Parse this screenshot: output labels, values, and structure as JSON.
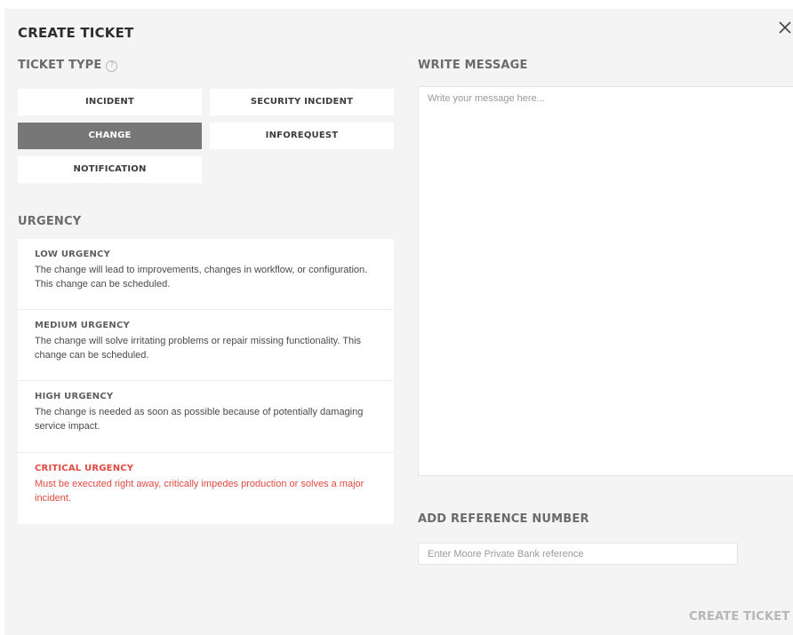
{
  "modal": {
    "title": "CREATE TICKET",
    "close_icon": "close-icon"
  },
  "ticket_type": {
    "heading": "TICKET TYPE",
    "help_icon": "help-circle-icon",
    "help_glyph": "?",
    "options": [
      {
        "label": "INCIDENT",
        "selected": false
      },
      {
        "label": "SECURITY INCIDENT",
        "selected": false
      },
      {
        "label": "CHANGE",
        "selected": true
      },
      {
        "label": "INFOREQUEST",
        "selected": false
      },
      {
        "label": "NOTIFICATION",
        "selected": false
      }
    ]
  },
  "urgency": {
    "heading": "URGENCY",
    "items": [
      {
        "title": "LOW URGENCY",
        "description": "The change will lead to improvements, changes in workflow, or configuration. This change can be scheduled."
      },
      {
        "title": "MEDIUM URGENCY",
        "description": "The change will solve irritating problems or repair missing functionality. This change can be scheduled."
      },
      {
        "title": "HIGH URGENCY",
        "description": "The change is needed as soon as possible because of potentially damaging service impact."
      },
      {
        "title": "CRITICAL URGENCY",
        "description": "Must be executed right away, critically impedes production or solves a major incident."
      }
    ]
  },
  "message": {
    "heading": "WRITE MESSAGE",
    "placeholder": "Write your message here...",
    "value": ""
  },
  "reference": {
    "heading": "ADD REFERENCE NUMBER",
    "placeholder": "Enter Moore Private Bank reference",
    "value": ""
  },
  "actions": {
    "create_label": "CREATE TICKET"
  },
  "colors": {
    "selected_bg": "#777777",
    "critical": "#e0493f",
    "panel_bg": "#f4f4f4"
  }
}
